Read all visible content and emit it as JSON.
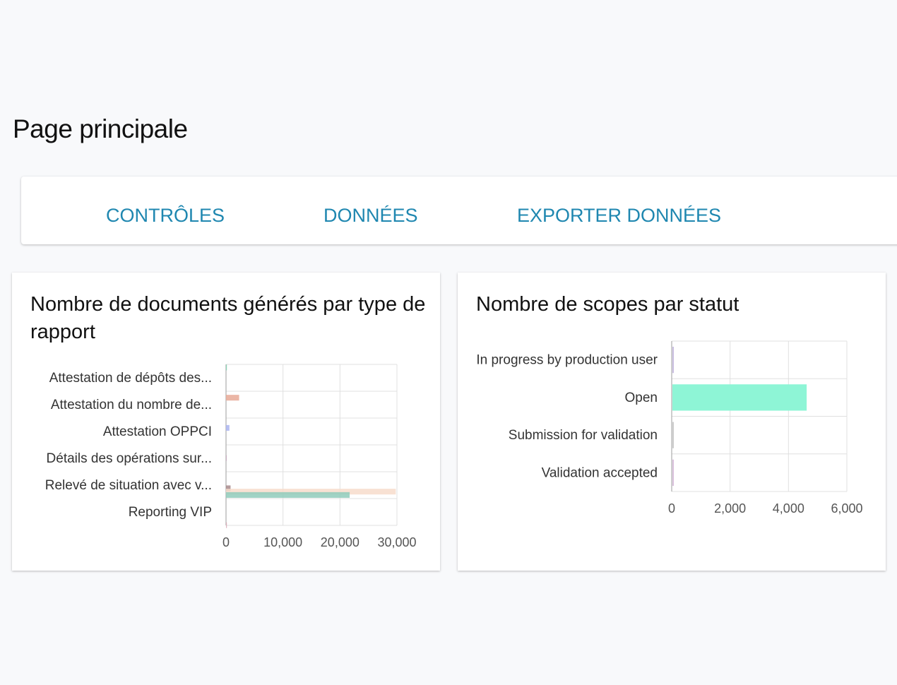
{
  "page": {
    "title": "Page principale"
  },
  "nav": {
    "tabs": [
      {
        "label": "CONTRÔLES"
      },
      {
        "label": "DONNÉES"
      },
      {
        "label": "EXPORTER DONNÉES"
      }
    ],
    "color": "#1f87b0"
  },
  "chart_data": [
    {
      "type": "bar",
      "orientation": "horizontal",
      "title": "Nombre de documents générés par type de rapport",
      "categories": [
        "Attestation de dépôts des...",
        "Attestation du nombre de...",
        "Attestation OPPCI",
        "Détails des opérations sur...",
        "Relevé de situation avec v...",
        "Reporting VIP"
      ],
      "series": [
        {
          "color": "#7fd3b0",
          "values": [
            150,
            0,
            0,
            0,
            0,
            0
          ]
        },
        {
          "color": "#e8a996",
          "values": [
            0,
            2300,
            0,
            0,
            0,
            0
          ]
        },
        {
          "color": "#aab4f0",
          "values": [
            0,
            0,
            600,
            0,
            0,
            0
          ]
        },
        {
          "color": "#c8a8c0",
          "values": [
            0,
            0,
            0,
            60,
            0,
            0
          ]
        },
        {
          "color": "#a88a8c",
          "values": [
            0,
            0,
            0,
            0,
            800,
            0
          ]
        },
        {
          "color": "#f7dccb",
          "values": [
            0,
            0,
            0,
            0,
            29800,
            0
          ]
        },
        {
          "color": "#8fcbbb",
          "values": [
            0,
            0,
            0,
            0,
            21700,
            0
          ]
        },
        {
          "color": "#d9a9b6",
          "values": [
            0,
            0,
            0,
            0,
            0,
            150
          ]
        }
      ],
      "xlim": [
        0,
        30000
      ],
      "xticks": [
        "0",
        "10,000",
        "20,000",
        "30,000"
      ],
      "grid": true
    },
    {
      "type": "bar",
      "orientation": "horizontal",
      "title": "Nombre de scopes par statut",
      "categories": [
        "In progress by production user",
        "Open",
        "Submission for validation",
        "Validation accepted"
      ],
      "values": [
        30,
        4600,
        0,
        40
      ],
      "colors": [
        "#c9bde0",
        "#8ef5d6",
        "#cccccc",
        "#d9c0dc"
      ],
      "xlim": [
        0,
        6000
      ],
      "xticks": [
        "0",
        "2,000",
        "4,000",
        "6,000"
      ],
      "grid": true
    }
  ]
}
